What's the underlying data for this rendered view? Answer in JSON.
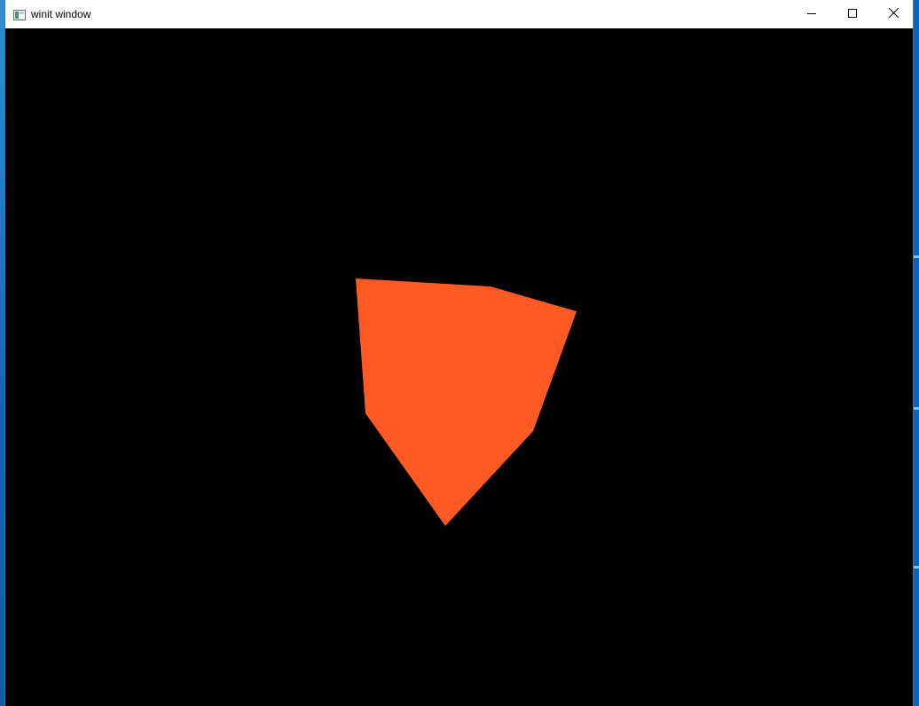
{
  "window": {
    "title": "winit window",
    "app_icon": "window-app-icon",
    "controls": {
      "minimize_icon": "minimize-icon",
      "maximize_icon": "maximize-icon",
      "close_icon": "close-icon"
    }
  },
  "scene": {
    "background_color": "#000000",
    "shape_color": "#ff5a24",
    "shape_description": "rotated-cube-silhouette"
  }
}
